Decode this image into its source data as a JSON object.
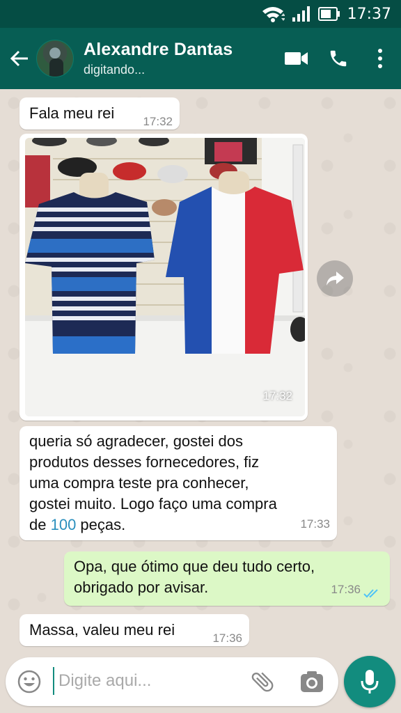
{
  "status_bar": {
    "time": "17:37"
  },
  "header": {
    "contact_name": "Alexandre Dantas",
    "contact_status": "digitando..."
  },
  "messages": [
    {
      "direction": "in",
      "text": "Fala meu rei",
      "time": "17:32"
    },
    {
      "direction": "in",
      "type": "image",
      "time": "17:32"
    },
    {
      "direction": "in",
      "lines": [
        "queria só agradecer, gostei dos",
        "produtos desses fornecedores, fiz",
        "uma compra teste pra conhecer,",
        "gostei muito. Logo faço uma compra"
      ],
      "last_line_prefix": "de ",
      "last_line_number": "100",
      "last_line_suffix": " peças.",
      "time": "17:33"
    },
    {
      "direction": "out",
      "lines": [
        "Opa, que ótimo que deu tudo certo,",
        "obrigado por avisar."
      ],
      "time": "17:36",
      "read": true
    },
    {
      "direction": "in",
      "text": "Massa, valeu meu rei",
      "time": "17:36"
    }
  ],
  "input": {
    "placeholder": "Digite aqui..."
  },
  "colors": {
    "header": "#075e54",
    "status_bar": "#054d44",
    "outgoing_bubble": "#dcf8c6",
    "accent": "#128c7e",
    "read_ticks": "#4fc3f7"
  },
  "icons": [
    "wifi-icon",
    "signal-icon",
    "battery-icon",
    "back-arrow-icon",
    "video-call-icon",
    "phone-icon",
    "more-vert-icon",
    "forward-icon",
    "emoji-icon",
    "attach-icon",
    "camera-icon",
    "mic-icon",
    "double-check-icon"
  ]
}
